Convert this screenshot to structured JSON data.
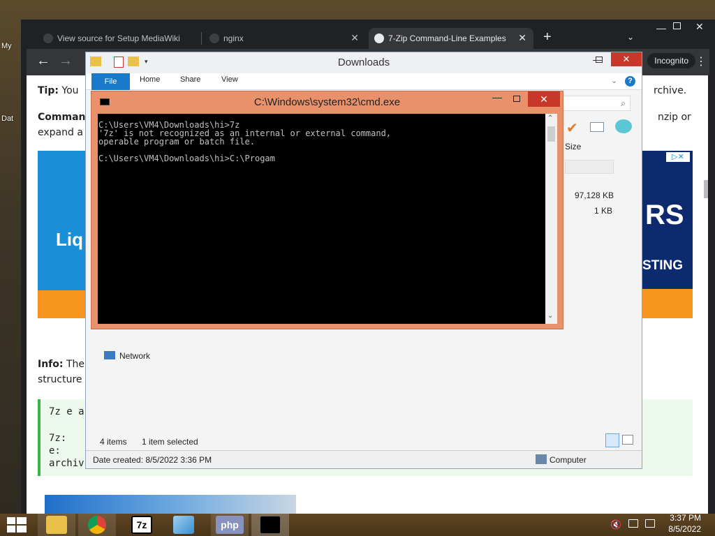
{
  "desktop": {
    "icons": [
      "My",
      "Dat"
    ]
  },
  "browser": {
    "tabs": [
      {
        "label": "View source for Setup MediaWiki"
      },
      {
        "label": "nginx"
      },
      {
        "label": "7-Zip Command-Line Examples",
        "active": true
      }
    ],
    "new_tab": "+",
    "incognito": "Incognito",
    "page": {
      "tip_label": "Tip:",
      "tip_text": "You",
      "tip_end": "rchive.",
      "command_label": "Comman",
      "command_text": "expand a",
      "command_end_1": "nzip or",
      "ad_left": "Liq",
      "ad_right_1": "RS",
      "ad_right_2": "STING",
      "info_label": "Info:",
      "info_text": "The",
      "info_text2": "structure",
      "code_lines": [
        "7z e a",
        "7z:",
        "e:",
        "archiv"
      ]
    }
  },
  "explorer": {
    "title": "Downloads",
    "ribbon_tabs": [
      "File",
      "Home",
      "Share",
      "View"
    ],
    "column_size": "Size",
    "sizes": [
      "97,128 KB",
      "1 KB"
    ],
    "nav_network": "Network",
    "items_count": "4 items",
    "selected": "1 item selected",
    "date_created": "Date created: 8/5/2022 3:36 PM",
    "computer": "Computer"
  },
  "cmd": {
    "title": "C:\\Windows\\system32\\cmd.exe",
    "output": "C:\\Users\\VM4\\Downloads\\hi>7z\n'7z' is not recognized as an internal or external command,\noperable program or batch file.\n\nC:\\Users\\VM4\\Downloads\\hi>C:\\Progam"
  },
  "taskbar": {
    "time": "3:37 PM",
    "date": "8/5/2022",
    "apps": [
      "File Explorer",
      "Chrome",
      "7-Zip",
      "Notepad",
      "PHP",
      "Command Prompt"
    ],
    "php_label": "php",
    "sevenzip_label": "7z",
    "colors": {
      "chrome_red": "#db4437",
      "cmd_black": "#000000"
    }
  }
}
